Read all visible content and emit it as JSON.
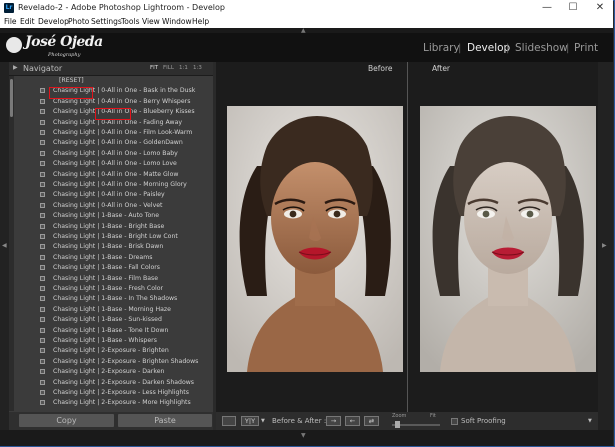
{
  "window": {
    "title": "Revelado-2 - Adobe Photoshop Lightroom - Develop",
    "app_icon": "Lr",
    "controls": {
      "minimize": "—",
      "maximize": "☐",
      "close": "✕"
    }
  },
  "menu": [
    "File",
    "Edit",
    "Develop",
    "Photo",
    "Settings",
    "Tools",
    "View",
    "Window",
    "Help"
  ],
  "identity_plate": {
    "name": "José Ojeda",
    "sub": "Photography"
  },
  "modules": [
    "Library",
    "Develop",
    "Slideshow",
    "Print"
  ],
  "active_module": "Develop",
  "navigator": {
    "label": "Navigator",
    "zoom": [
      "FIT",
      "FILL",
      "1:1",
      "1:3"
    ]
  },
  "presets": [
    "[RESET]",
    "Chasing Light | 0-All in One - Bask in the Dusk",
    "Chasing Light | 0-All in One - Berry Whispers",
    "Chasing Light | 0-All in One - Blueberry Kisses",
    "Chasing Light | 0-All in One - Fading Away",
    "Chasing Light | 0-All in One - Film Look-Warm",
    "Chasing Light | 0-All in One - GoldenDawn",
    "Chasing Light | 0-All in One - Lomo Baby",
    "Chasing Light | 0-All in One - Lomo Love",
    "Chasing Light | 0-All in One - Matte Glow",
    "Chasing Light | 0-All in One - Morning Glory",
    "Chasing Light | 0-All in One - Paisley",
    "Chasing Light | 0-All in One - Velvet",
    "Chasing Light | 1-Base - Auto Tone",
    "Chasing Light | 1-Base - Bright Base",
    "Chasing Light | 1-Base - Bright Low Cont",
    "Chasing Light | 1-Base - Brisk Dawn",
    "Chasing Light | 1-Base - Dreams",
    "Chasing Light | 1-Base - Fall Colors",
    "Chasing Light | 1-Base - Film Base",
    "Chasing Light | 1-Base - Fresh Color",
    "Chasing Light | 1-Base - In The Shadows",
    "Chasing Light | 1-Base - Morning Haze",
    "Chasing Light | 1-Base - Sun-kissed",
    "Chasing Light | 1-Base - Tone It Down",
    "Chasing Light | 1-Base - Whispers",
    "Chasing Light | 2-Exposure - Brighten",
    "Chasing Light | 2-Exposure - Brighten Shadows",
    "Chasing Light | 2-Exposure - Darken",
    "Chasing Light | 2-Exposure - Darken Shadows",
    "Chasing Light | 2-Exposure - Less Highlights",
    "Chasing Light | 2-Exposure - More Highlights"
  ],
  "copy_button": "Copy",
  "paste_button": "Paste",
  "before_label": "Before",
  "after_label": "After",
  "toolbar": {
    "view_mode": "Y|Y",
    "before_after": "Before & After :",
    "zoom_label": "Zoom",
    "zoom_fit": "Fit",
    "soft_proofing": "Soft Proofing"
  },
  "colors": {
    "annotation_red": "#e2131b",
    "lips": "#b5162a",
    "accent": "#f0f0f0"
  }
}
